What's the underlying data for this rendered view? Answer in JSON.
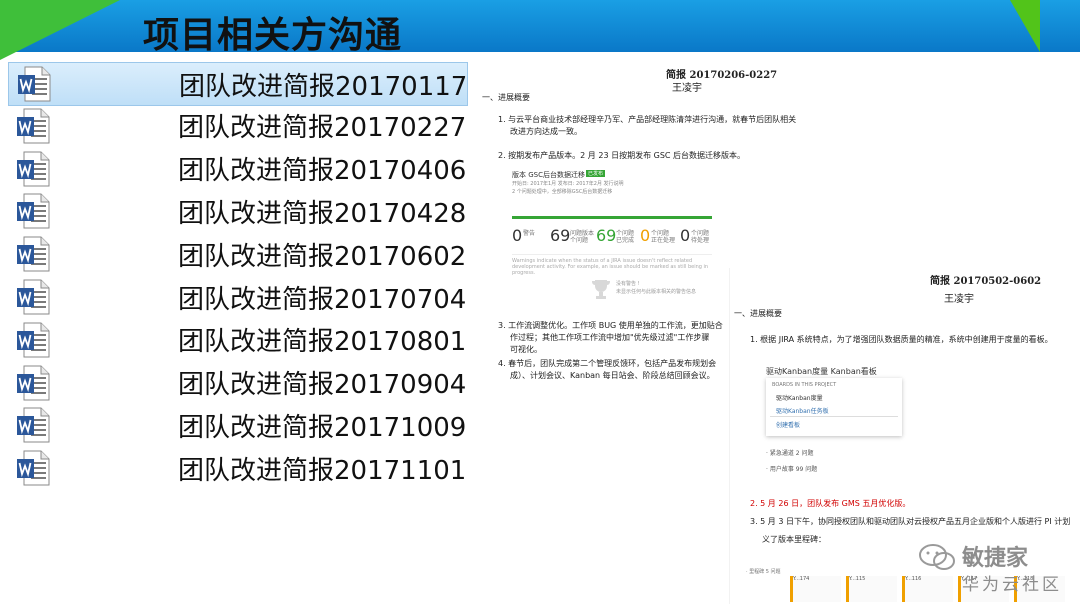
{
  "slide": {
    "title": "项目相关方沟通"
  },
  "files": [
    {
      "name": "团队改进简报20170117",
      "selected": true
    },
    {
      "name": "团队改进简报20170227",
      "selected": false
    },
    {
      "name": "团队改进简报20170406",
      "selected": false
    },
    {
      "name": "团队改进简报20170428",
      "selected": false
    },
    {
      "name": "团队改进简报20170602",
      "selected": false
    },
    {
      "name": "团队改进简报20170704",
      "selected": false
    },
    {
      "name": "团队改进简报20170801",
      "selected": false
    },
    {
      "name": "团队改进简报20170904",
      "selected": false
    },
    {
      "name": "团队改进简报20171009",
      "selected": false
    },
    {
      "name": "团队改进简报20171101",
      "selected": false
    }
  ],
  "doc1": {
    "title": "简报 20170206-0227",
    "author": "王凌宇",
    "section": "一、进展概要",
    "item1_line1": "1.   与云平台商业技术部经理辛乃军、产品部经理陈清萍进行沟通，就春节后团队相关",
    "item1_line2": "改进方向达成一致。",
    "item2": "2.   按期发布产品版本。2 月 23 日按期发布 GSC 后台数据迁移版本。",
    "card": {
      "title": "版本 GSC后台数据迁移",
      "badge": "已发布",
      "meta": "开始日: 2017年1月  发布日: 2017年2月  发行说明",
      "note": "2 个问题处理中，全部移除GSC后台数据迁移",
      "stats": [
        {
          "value": "0",
          "label": "警告"
        },
        {
          "value": "69",
          "label": "问题版本 个问题"
        },
        {
          "value": "69",
          "label": "个问题 已完成"
        },
        {
          "value": "0",
          "label": "个问题 正在处理"
        },
        {
          "value": "0",
          "label": "个问题 待处理"
        }
      ],
      "warning": "Warnings indicate when the status of a JIRA issue doesn't reflect related development activity. For example, an issue should be marked as still being in progress.",
      "empty": "没有警告 !",
      "empty_sub": "未显示任何与此版本相关的警告信息"
    },
    "item3_line1": "3.   工作流调整优化。工作项 BUG 使用单独的工作流，更加贴合",
    "item3_line2": "作过程；其他工作项工作流中增加\"优先级过滤\"工作步骤",
    "item3_line3": "可视化。",
    "item4_line1": "4.   春节后，团队完成第二个管理反馈环，包括产品发布规划会",
    "item4_line2": "成）、计划会议、Kanban 每日站会、阶段总结回顾会议。"
  },
  "doc2": {
    "title": "简报 20170502-0602",
    "author": "王凌宇",
    "section": "一、进展概要",
    "item1": "1.   根据 JIRA 系统特点，为了增强团队数据质量的精准，系统中创建用于度量的看板。",
    "board_title": "驱动Kanban度量  Kanban看板",
    "boards_header": "BOARDS IN THIS PROJECT",
    "board1": "驱动Kanban度量",
    "board2": "驱动Kanban任务板",
    "board3": "创建看板",
    "list1": "· 紧急通道 2 问题",
    "list2": "· 用户故事 99 问题",
    "item2": "2.   5 月 26 日，团队发布 GMS 五月优化版。",
    "item3_line1": "3.   5 月 3 日下午，协同授权团队和驱动团队对云授权产品五月企业版和个人版进行 PI 计划",
    "item3_line2": "义了版本里程碑：",
    "bottom_label": "· 里程碑 5 问题",
    "chips": [
      "Y...174",
      "Y...115",
      "Y...116",
      "Y...117",
      "Y...118"
    ]
  },
  "watermark": {
    "name": "敏捷家",
    "sub": "华为云社区"
  },
  "colors": {
    "banner_blue": "#0a78c8",
    "banner_green": "#3fbf3a",
    "word_blue": "#2b579a",
    "progress_green": "#35a535",
    "highlight_red": "#d10000"
  }
}
